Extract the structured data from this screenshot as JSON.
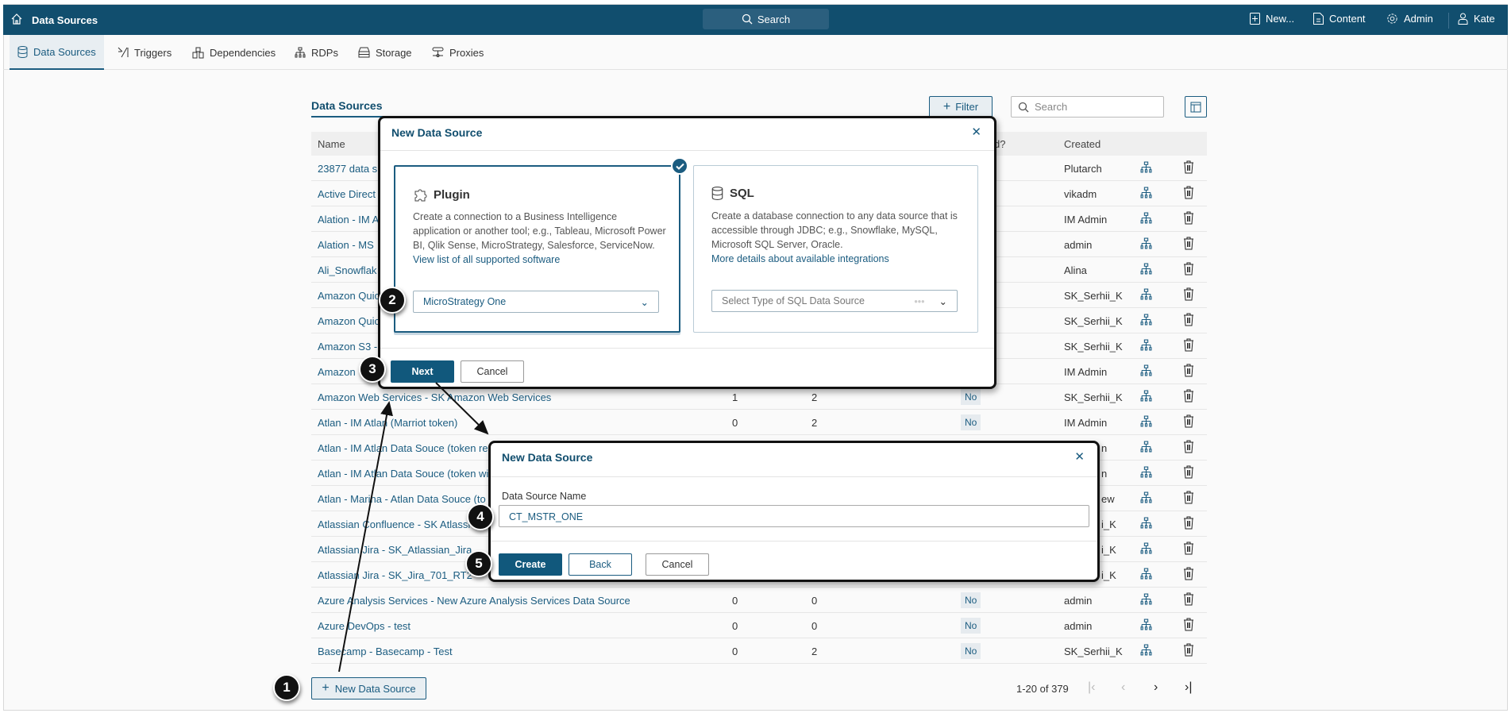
{
  "topbar": {
    "title": "Data Sources",
    "search": "Search",
    "new": "New...",
    "content": "Content",
    "admin": "Admin",
    "user": "Kate"
  },
  "tabs": [
    {
      "label": "Data Sources"
    },
    {
      "label": "Triggers"
    },
    {
      "label": "Dependencies"
    },
    {
      "label": "RDPs"
    },
    {
      "label": "Storage"
    },
    {
      "label": "Proxies"
    }
  ],
  "page": {
    "title": "Data Sources",
    "filter": "Filter",
    "search_placeholder": "Search"
  },
  "table": {
    "headers": {
      "name": "Name",
      "partial": "d?",
      "created": "Created"
    },
    "rows": [
      {
        "name": "23877 data s",
        "created": "Plutarch"
      },
      {
        "name": "Active Direct",
        "created": "vikadm"
      },
      {
        "name": "Alation - IM A",
        "created": "IM Admin"
      },
      {
        "name": "Alation - MS",
        "created": "admin"
      },
      {
        "name": "Ali_Snowflak",
        "created": "Alina"
      },
      {
        "name": "Amazon Quic",
        "created": "SK_Serhii_K"
      },
      {
        "name": "Amazon Quic",
        "created": "SK_Serhii_K"
      },
      {
        "name": "Amazon S3 -",
        "created": "SK_Serhii_K"
      },
      {
        "name": "Amazon",
        "created": "IM Admin"
      },
      {
        "name": "Amazon Web Services - SK Amazon Web Services",
        "c1": "1",
        "c2": "2",
        "badge": "No",
        "created": "SK_Serhii_K"
      },
      {
        "name": "Atlan - IM Atlan (Marriot token)",
        "c1": "0",
        "c2": "2",
        "badge": "No",
        "created": "IM Admin"
      },
      {
        "name": "Atlan - IM Atlan Data Souce (token re",
        "created_partial": "n"
      },
      {
        "name": "Atlan - IM Atlan Data Souce (token wi",
        "created_partial": "n"
      },
      {
        "name": "Atlan - Marina - Atlan Data Souce (to",
        "created_partial": "ew"
      },
      {
        "name": "Atlassian Confluence - SK Atlassi",
        "created_partial": "i_K"
      },
      {
        "name": "Atlassian Jira - SK_Atlassian_Jira",
        "created_partial": "i_K"
      },
      {
        "name": "Atlassian Jira - SK_Jira_701_RT2",
        "created_partial": "i_K"
      },
      {
        "name": "Azure Analysis Services - New Azure Analysis Services Data Source",
        "c1": "0",
        "c2": "0",
        "badge": "No",
        "created": "admin"
      },
      {
        "name": "Azure DevOps - test",
        "c1": "0",
        "c2": "0",
        "badge": "No",
        "created": "admin"
      },
      {
        "name": "Basecamp - Basecamp - Test",
        "c1": "0",
        "c2": "2",
        "badge": "No",
        "created": "SK_Serhii_K"
      }
    ]
  },
  "footer": {
    "new_button": "New Data Source",
    "pagination": "1-20 of 379"
  },
  "modal1": {
    "title": "New Data Source",
    "plugin": {
      "title": "Plugin",
      "desc": "Create a connection to a Business Intelligence application or another tool; e.g., Tableau, Microsoft Power BI, Qlik Sense, MicroStrategy, Salesforce, ServiceNow.",
      "link": "View list of all supported software",
      "select": "MicroStrategy One"
    },
    "sql": {
      "title": "SQL",
      "desc": "Create a database connection to any data source that is accessible through JDBC; e.g., Snowflake, MySQL, Microsoft SQL Server, Oracle.",
      "link": "More details about available integrations",
      "select": "Select Type of SQL Data Source"
    },
    "next": "Next",
    "cancel": "Cancel"
  },
  "modal2": {
    "title": "New Data Source",
    "label": "Data Source Name",
    "value": "CT_MSTR_ONE",
    "create": "Create",
    "back": "Back",
    "cancel": "Cancel"
  },
  "callouts": [
    "1",
    "2",
    "3",
    "4",
    "5"
  ],
  "colors": {
    "brand": "#114e6e",
    "link": "#1b5c80"
  }
}
